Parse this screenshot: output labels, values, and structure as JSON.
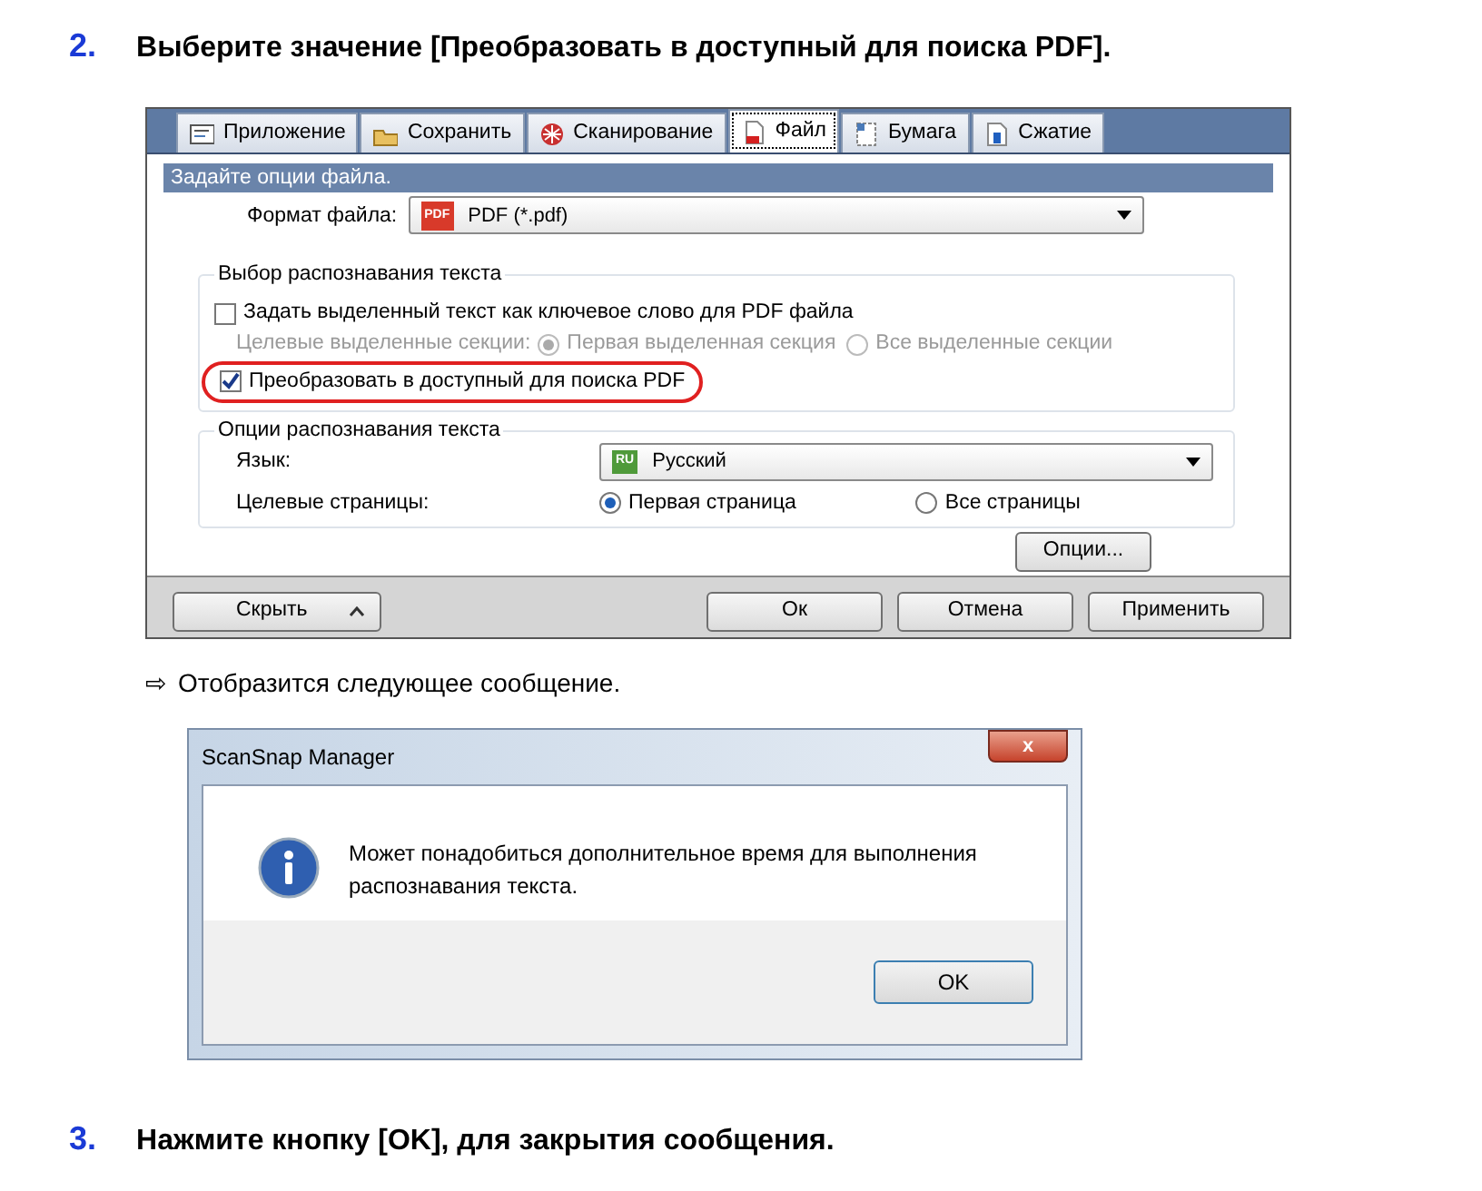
{
  "step_first": {
    "number": "2.",
    "text": "Выберите значение [Преобразовать в доступный для поиска PDF]."
  },
  "settings_dialog": {
    "tabs": [
      {
        "label": "Приложение",
        "selected": false
      },
      {
        "label": "Сохранить",
        "selected": false
      },
      {
        "label": "Сканирование",
        "selected": false
      },
      {
        "label": "Файл",
        "selected": true
      },
      {
        "label": "Бумага",
        "selected": false
      },
      {
        "label": "Сжатие",
        "selected": false
      }
    ],
    "section_title": "Задайте опции файла.",
    "file_format": {
      "label": "Формат файла:",
      "badge": "PDF",
      "value": "PDF (*.pdf)"
    },
    "recognition_group": {
      "title": "Выбор распознавания текста",
      "keyword_checkbox": {
        "label": "Задать выделенный текст как ключевое слово для PDF файла",
        "checked": false
      },
      "target_sections": {
        "label": "Целевые выделенные секции:",
        "disabled": true,
        "options": [
          {
            "label": "Первая выделенная секция",
            "selected": true
          },
          {
            "label": "Все выделенные секции",
            "selected": false
          }
        ]
      },
      "searchable_pdf": {
        "label": "Преобразовать в доступный для поиска PDF",
        "checked": true,
        "highlighted": true
      }
    },
    "ocr_group": {
      "title": "Опции распознавания текста",
      "language": {
        "label": "Язык:",
        "badge": "RU",
        "value": "Русский"
      },
      "target_pages": {
        "label": "Целевые страницы:",
        "options": [
          {
            "label": "Первая страница",
            "selected": true
          },
          {
            "label": "Все страницы",
            "selected": false
          }
        ]
      },
      "options_button": "Опции..."
    },
    "hide_button": "Скрыть",
    "buttons": [
      "Ок",
      "Отмена",
      "Применить"
    ]
  },
  "result_note": {
    "arrow": "⇨",
    "text": "Отобразится следующее сообщение."
  },
  "message_box": {
    "title": "ScanSnap Manager",
    "close": "x",
    "message": "Может понадобиться дополнительное время для выполнения распознавания текста.",
    "button": "OK"
  },
  "step_second": {
    "number": "3.",
    "text": "Нажмите кнопку [OK], для закрытия сообщения."
  }
}
